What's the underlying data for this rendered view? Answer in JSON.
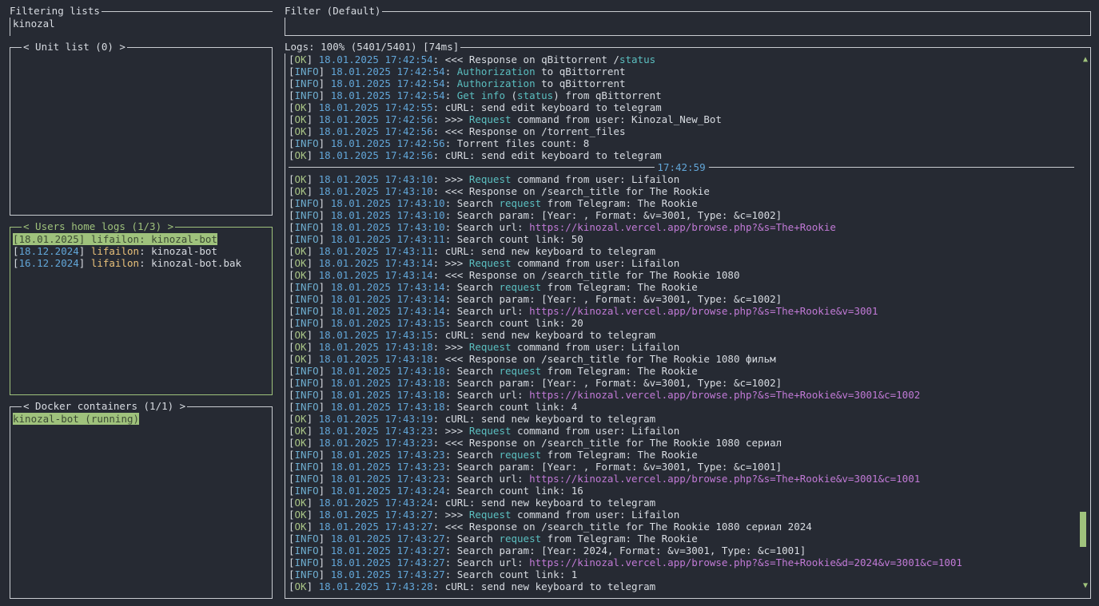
{
  "filtering": {
    "title": "Filtering lists",
    "value": "kinozal"
  },
  "filter": {
    "title": "Filter (Default)",
    "value": ""
  },
  "unit_list": {
    "title": "< Unit list (0) >"
  },
  "users_logs": {
    "title": "< Users home logs (1/3) >",
    "items": [
      {
        "date": "18.01.2025",
        "user": "lifailon",
        "path": "kinozal-bot"
      },
      {
        "date": "18.12.2024",
        "user": "lifailon",
        "path": "kinozal-bot"
      },
      {
        "date": "16.12.2024",
        "user": "lifailon",
        "path": "kinozal-bot.bak"
      }
    ]
  },
  "docker": {
    "title": "< Docker containers (1/1) >",
    "items": [
      "kinozal-bot (running)"
    ]
  },
  "logs": {
    "title": "Logs: 100% (5401/5401) [74ms]",
    "separator": "17:42:59",
    "scroll_up": "▲",
    "scroll_down": "▼",
    "scroll_level": 0.93,
    "lines_before": [
      {
        "lvl": "OK",
        "ts": "18.01.2025 17:42:54",
        "parts": [
          {
            "t": "<<< Response on qBittorrent /"
          },
          {
            "t": "status",
            "c": "kw"
          }
        ]
      },
      {
        "lvl": "INFO",
        "ts": "18.01.2025 17:42:54",
        "parts": [
          {
            "t": "Authorization",
            "c": "kw"
          },
          {
            "t": " to qBittorrent"
          }
        ]
      },
      {
        "lvl": "INFO",
        "ts": "18.01.2025 17:42:54",
        "parts": [
          {
            "t": "Authorization",
            "c": "kw"
          },
          {
            "t": " to qBittorrent"
          }
        ]
      },
      {
        "lvl": "INFO",
        "ts": "18.01.2025 17:42:54",
        "parts": [
          {
            "t": "Get info",
            "c": "kw"
          },
          {
            "t": " ("
          },
          {
            "t": "status",
            "c": "kw"
          },
          {
            "t": ") from qBittorrent"
          }
        ]
      },
      {
        "lvl": "OK",
        "ts": "18.01.2025 17:42:55",
        "parts": [
          {
            "t": "cURL: send edit keyboard to telegram"
          }
        ]
      },
      {
        "lvl": "OK",
        "ts": "18.01.2025 17:42:56",
        "parts": [
          {
            "t": ">>> "
          },
          {
            "t": "Request",
            "c": "kw"
          },
          {
            "t": " command from user: Kinozal_New_Bot"
          }
        ]
      },
      {
        "lvl": "OK",
        "ts": "18.01.2025 17:42:56",
        "parts": [
          {
            "t": "<<< Response on /torrent_files"
          }
        ]
      },
      {
        "lvl": "INFO",
        "ts": "18.01.2025 17:42:56",
        "parts": [
          {
            "t": "Torrent files count: 8"
          }
        ]
      },
      {
        "lvl": "OK",
        "ts": "18.01.2025 17:42:56",
        "parts": [
          {
            "t": "cURL: send edit keyboard to telegram"
          }
        ]
      }
    ],
    "lines_after": [
      {
        "lvl": "OK",
        "ts": "18.01.2025 17:43:10",
        "parts": [
          {
            "t": ">>> "
          },
          {
            "t": "Request",
            "c": "kw"
          },
          {
            "t": " command from user: Lifailon"
          }
        ]
      },
      {
        "lvl": "OK",
        "ts": "18.01.2025 17:43:10",
        "parts": [
          {
            "t": "<<< Response on /search_title for The Rookie"
          }
        ]
      },
      {
        "lvl": "INFO",
        "ts": "18.01.2025 17:43:10",
        "parts": [
          {
            "t": "Search "
          },
          {
            "t": "request",
            "c": "kw"
          },
          {
            "t": " from Telegram: The Rookie"
          }
        ]
      },
      {
        "lvl": "INFO",
        "ts": "18.01.2025 17:43:10",
        "parts": [
          {
            "t": "Search param: [Year: , Format: &v=3001, Type: &c=1002]"
          }
        ]
      },
      {
        "lvl": "INFO",
        "ts": "18.01.2025 17:43:10",
        "parts": [
          {
            "t": "Search url: "
          },
          {
            "t": "https://kinozal.vercel.app/browse.php?&s=The+Rookie",
            "c": "url"
          }
        ]
      },
      {
        "lvl": "INFO",
        "ts": "18.01.2025 17:43:11",
        "parts": [
          {
            "t": "Search count link: 50"
          }
        ]
      },
      {
        "lvl": "OK",
        "ts": "18.01.2025 17:43:11",
        "parts": [
          {
            "t": "cURL: send new keyboard to telegram"
          }
        ]
      },
      {
        "lvl": "OK",
        "ts": "18.01.2025 17:43:14",
        "parts": [
          {
            "t": ">>> "
          },
          {
            "t": "Request",
            "c": "kw"
          },
          {
            "t": " command from user: Lifailon"
          }
        ]
      },
      {
        "lvl": "OK",
        "ts": "18.01.2025 17:43:14",
        "parts": [
          {
            "t": "<<< Response on /search_title for The Rookie 1080"
          }
        ]
      },
      {
        "lvl": "INFO",
        "ts": "18.01.2025 17:43:14",
        "parts": [
          {
            "t": "Search "
          },
          {
            "t": "request",
            "c": "kw"
          },
          {
            "t": " from Telegram: The Rookie"
          }
        ]
      },
      {
        "lvl": "INFO",
        "ts": "18.01.2025 17:43:14",
        "parts": [
          {
            "t": "Search param: [Year: , Format: &v=3001, Type: &c=1002]"
          }
        ]
      },
      {
        "lvl": "INFO",
        "ts": "18.01.2025 17:43:14",
        "parts": [
          {
            "t": "Search url: "
          },
          {
            "t": "https://kinozal.vercel.app/browse.php?&s=The+Rookie&v=3001",
            "c": "url"
          }
        ]
      },
      {
        "lvl": "INFO",
        "ts": "18.01.2025 17:43:15",
        "parts": [
          {
            "t": "Search count link: 20"
          }
        ]
      },
      {
        "lvl": "OK",
        "ts": "18.01.2025 17:43:15",
        "parts": [
          {
            "t": "cURL: send new keyboard to telegram"
          }
        ]
      },
      {
        "lvl": "OK",
        "ts": "18.01.2025 17:43:18",
        "parts": [
          {
            "t": ">>> "
          },
          {
            "t": "Request",
            "c": "kw"
          },
          {
            "t": " command from user: Lifailon"
          }
        ]
      },
      {
        "lvl": "OK",
        "ts": "18.01.2025 17:43:18",
        "parts": [
          {
            "t": "<<< Response on /search_title for The Rookie 1080 фильм"
          }
        ]
      },
      {
        "lvl": "INFO",
        "ts": "18.01.2025 17:43:18",
        "parts": [
          {
            "t": "Search "
          },
          {
            "t": "request",
            "c": "kw"
          },
          {
            "t": " from Telegram: The Rookie"
          }
        ]
      },
      {
        "lvl": "INFO",
        "ts": "18.01.2025 17:43:18",
        "parts": [
          {
            "t": "Search param: [Year: , Format: &v=3001, Type: &c=1002]"
          }
        ]
      },
      {
        "lvl": "INFO",
        "ts": "18.01.2025 17:43:18",
        "parts": [
          {
            "t": "Search url: "
          },
          {
            "t": "https://kinozal.vercel.app/browse.php?&s=The+Rookie&v=3001&c=1002",
            "c": "url"
          }
        ]
      },
      {
        "lvl": "INFO",
        "ts": "18.01.2025 17:43:18",
        "parts": [
          {
            "t": "Search count link: 4"
          }
        ]
      },
      {
        "lvl": "OK",
        "ts": "18.01.2025 17:43:19",
        "parts": [
          {
            "t": "cURL: send new keyboard to telegram"
          }
        ]
      },
      {
        "lvl": "OK",
        "ts": "18.01.2025 17:43:23",
        "parts": [
          {
            "t": ">>> "
          },
          {
            "t": "Request",
            "c": "kw"
          },
          {
            "t": " command from user: Lifailon"
          }
        ]
      },
      {
        "lvl": "OK",
        "ts": "18.01.2025 17:43:23",
        "parts": [
          {
            "t": "<<< Response on /search_title for The Rookie 1080 сериал"
          }
        ]
      },
      {
        "lvl": "INFO",
        "ts": "18.01.2025 17:43:23",
        "parts": [
          {
            "t": "Search "
          },
          {
            "t": "request",
            "c": "kw"
          },
          {
            "t": " from Telegram: The Rookie"
          }
        ]
      },
      {
        "lvl": "INFO",
        "ts": "18.01.2025 17:43:23",
        "parts": [
          {
            "t": "Search param: [Year: , Format: &v=3001, Type: &c=1001]"
          }
        ]
      },
      {
        "lvl": "INFO",
        "ts": "18.01.2025 17:43:23",
        "parts": [
          {
            "t": "Search url: "
          },
          {
            "t": "https://kinozal.vercel.app/browse.php?&s=The+Rookie&v=3001&c=1001",
            "c": "url"
          }
        ]
      },
      {
        "lvl": "INFO",
        "ts": "18.01.2025 17:43:24",
        "parts": [
          {
            "t": "Search count link: 16"
          }
        ]
      },
      {
        "lvl": "OK",
        "ts": "18.01.2025 17:43:24",
        "parts": [
          {
            "t": "cURL: send new keyboard to telegram"
          }
        ]
      },
      {
        "lvl": "OK",
        "ts": "18.01.2025 17:43:27",
        "parts": [
          {
            "t": ">>> "
          },
          {
            "t": "Request",
            "c": "kw"
          },
          {
            "t": " command from user: Lifailon"
          }
        ]
      },
      {
        "lvl": "OK",
        "ts": "18.01.2025 17:43:27",
        "parts": [
          {
            "t": "<<< Response on /search_title for The Rookie 1080 сериал 2024"
          }
        ]
      },
      {
        "lvl": "INFO",
        "ts": "18.01.2025 17:43:27",
        "parts": [
          {
            "t": "Search "
          },
          {
            "t": "request",
            "c": "kw"
          },
          {
            "t": " from Telegram: The Rookie"
          }
        ]
      },
      {
        "lvl": "INFO",
        "ts": "18.01.2025 17:43:27",
        "parts": [
          {
            "t": "Search param: [Year: 2024, Format: &v=3001, Type: &c=1001]"
          }
        ]
      },
      {
        "lvl": "INFO",
        "ts": "18.01.2025 17:43:27",
        "parts": [
          {
            "t": "Search url: "
          },
          {
            "t": "https://kinozal.vercel.app/browse.php?&s=The+Rookie&d=2024&v=3001&c=1001",
            "c": "url"
          }
        ]
      },
      {
        "lvl": "INFO",
        "ts": "18.01.2025 17:43:27",
        "parts": [
          {
            "t": "Search count link: 1"
          }
        ]
      },
      {
        "lvl": "OK",
        "ts": "18.01.2025 17:43:28",
        "parts": [
          {
            "t": "cURL: send new keyboard to telegram"
          }
        ]
      }
    ]
  }
}
